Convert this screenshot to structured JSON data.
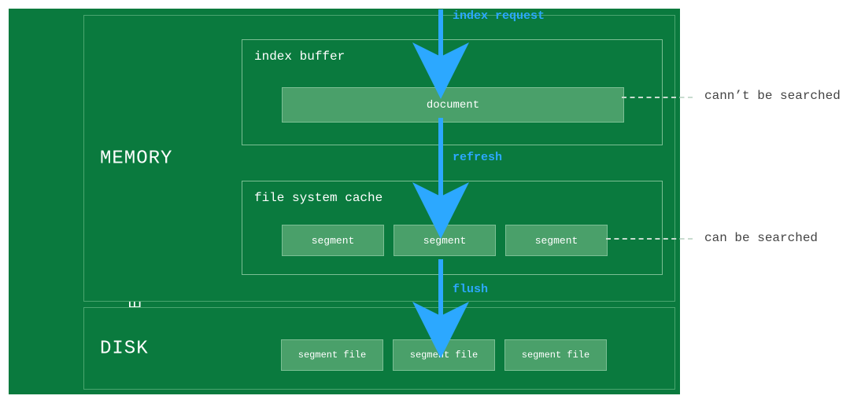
{
  "node_label": "ELASTICSEARCH  NODE",
  "memory": {
    "label": "MEMORY",
    "index_buffer": {
      "title": "index buffer",
      "document": "document"
    },
    "fs_cache": {
      "title": "file system cache",
      "segments": [
        "segment",
        "segment",
        "segment"
      ]
    }
  },
  "disk": {
    "label": "DISK",
    "files": [
      "segment file",
      "segment file",
      "segment file"
    ]
  },
  "arrows": {
    "index_request": "index request",
    "refresh": "refresh",
    "flush": "flush"
  },
  "annotations": {
    "cannot_search": "cann’t be searched",
    "can_search": "can be searched"
  },
  "colors": {
    "bg": "#0a7a3e",
    "box": "#4aa06a",
    "arrow": "#2ca8ff"
  }
}
